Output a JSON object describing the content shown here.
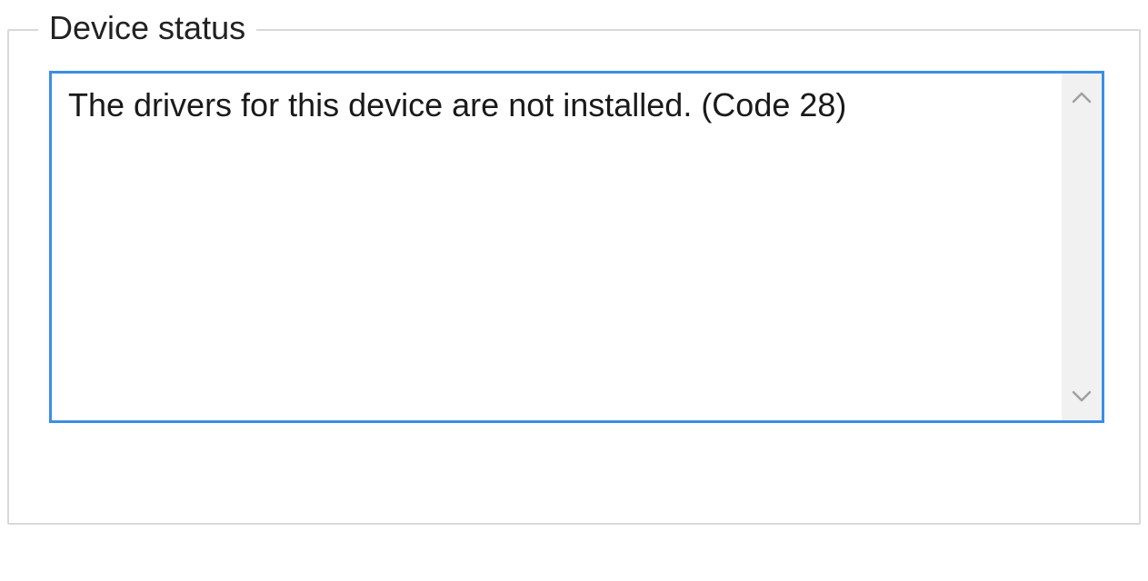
{
  "groupbox": {
    "legend": "Device status"
  },
  "status": {
    "message": "The drivers for this device are not installed. (Code 28)"
  }
}
